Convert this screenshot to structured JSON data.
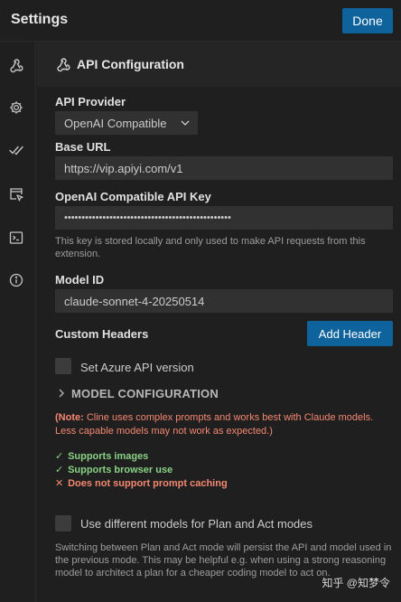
{
  "header": {
    "title": "Settings",
    "done_label": "Done"
  },
  "sidebar": {
    "items": [
      {
        "icon": "webhook-icon"
      },
      {
        "icon": "gear-icon"
      },
      {
        "icon": "check-all-icon"
      },
      {
        "icon": "browser-cursor-icon"
      },
      {
        "icon": "terminal-icon"
      },
      {
        "icon": "info-icon"
      }
    ]
  },
  "section": {
    "title": "API Configuration",
    "icon": "webhook-icon"
  },
  "api_provider": {
    "label": "API Provider",
    "value": "OpenAI Compatible"
  },
  "base_url": {
    "label": "Base URL",
    "value": "https://vip.apiyi.com/v1"
  },
  "api_key": {
    "label": "OpenAI Compatible API Key",
    "value": "••••••••••••••••••••••••••••••••••••••••••••••••",
    "note": "This key is stored locally and only used to make API requests from this extension."
  },
  "model_id": {
    "label": "Model ID",
    "value": "claude-sonnet-4-20250514"
  },
  "custom_headers": {
    "label": "Custom Headers",
    "add_label": "Add Header"
  },
  "azure": {
    "label": "Set Azure API version",
    "checked": false
  },
  "model_config": {
    "label": "MODEL CONFIGURATION"
  },
  "warning": {
    "prefix": "(Note:",
    "text": " Cline uses complex prompts and works best with Claude models. Less capable models may not work as expected.)"
  },
  "capabilities": [
    {
      "mark": "✓",
      "text": "Supports images",
      "status": "ok"
    },
    {
      "mark": "✓",
      "text": "Supports browser use",
      "status": "ok"
    },
    {
      "mark": "✕",
      "text": "Does not support prompt caching",
      "status": "bad"
    }
  ],
  "plan_act": {
    "label": "Use different models for Plan and Act modes",
    "checked": false,
    "note": "Switching between Plan and Act mode will persist the API and model used in the previous mode. This may be helpful e.g. when using a strong reasoning model to architect a plan for a cheaper coding model to act on."
  },
  "watermark": "知乎 @知梦令",
  "colors": {
    "accent": "#0e639c",
    "ok": "#89d185",
    "error": "#f48771",
    "background": "#1f1f1f"
  }
}
